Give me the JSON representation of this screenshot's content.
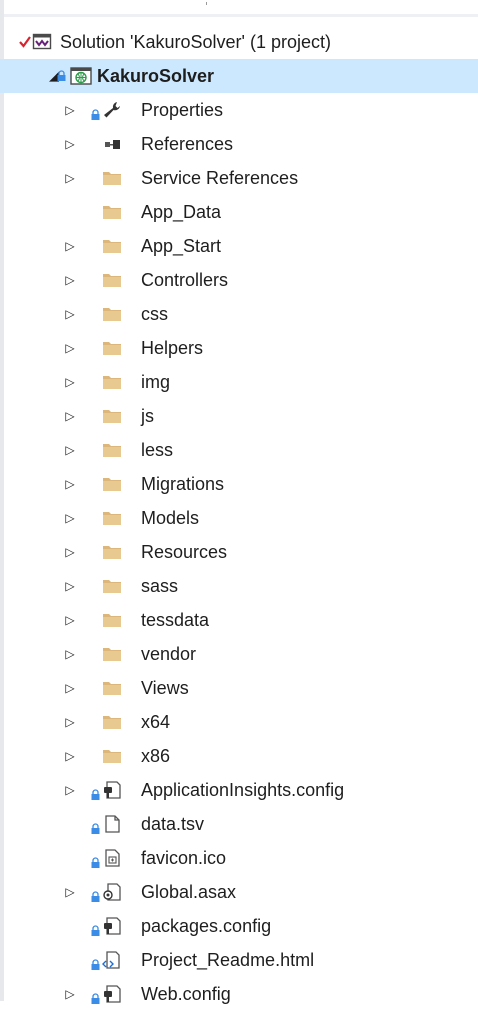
{
  "solution": {
    "label": "Solution 'KakuroSolver' (1 project)"
  },
  "project": {
    "label": "KakuroSolver"
  },
  "items": [
    {
      "label": "Properties",
      "icon": "wrench-icon",
      "expander": true,
      "lock": true
    },
    {
      "label": "References",
      "icon": "references-icon",
      "expander": true,
      "lock": false
    },
    {
      "label": "Service References",
      "icon": "folder-icon",
      "expander": true,
      "lock": false
    },
    {
      "label": "App_Data",
      "icon": "folder-icon",
      "expander": false,
      "lock": false
    },
    {
      "label": "App_Start",
      "icon": "folder-icon",
      "expander": true,
      "lock": false
    },
    {
      "label": "Controllers",
      "icon": "folder-icon",
      "expander": true,
      "lock": false
    },
    {
      "label": "css",
      "icon": "folder-icon",
      "expander": true,
      "lock": false
    },
    {
      "label": "Helpers",
      "icon": "folder-icon",
      "expander": true,
      "lock": false
    },
    {
      "label": "img",
      "icon": "folder-icon",
      "expander": true,
      "lock": false
    },
    {
      "label": "js",
      "icon": "folder-icon",
      "expander": true,
      "lock": false
    },
    {
      "label": "less",
      "icon": "folder-icon",
      "expander": true,
      "lock": false
    },
    {
      "label": "Migrations",
      "icon": "folder-icon",
      "expander": true,
      "lock": false
    },
    {
      "label": "Models",
      "icon": "folder-icon",
      "expander": true,
      "lock": false
    },
    {
      "label": "Resources",
      "icon": "folder-icon",
      "expander": true,
      "lock": false
    },
    {
      "label": "sass",
      "icon": "folder-icon",
      "expander": true,
      "lock": false
    },
    {
      "label": "tessdata",
      "icon": "folder-icon",
      "expander": true,
      "lock": false
    },
    {
      "label": "vendor",
      "icon": "folder-icon",
      "expander": true,
      "lock": false
    },
    {
      "label": "Views",
      "icon": "folder-icon",
      "expander": true,
      "lock": false
    },
    {
      "label": "x64",
      "icon": "folder-icon",
      "expander": true,
      "lock": false
    },
    {
      "label": "x86",
      "icon": "folder-icon",
      "expander": true,
      "lock": false
    },
    {
      "label": "ApplicationInsights.config",
      "icon": "config-file-icon",
      "expander": true,
      "lock": true
    },
    {
      "label": "data.tsv",
      "icon": "blank-file-icon",
      "expander": false,
      "lock": true
    },
    {
      "label": "favicon.ico",
      "icon": "image-file-icon",
      "expander": false,
      "lock": true
    },
    {
      "label": "Global.asax",
      "icon": "asax-file-icon",
      "expander": true,
      "lock": true
    },
    {
      "label": "packages.config",
      "icon": "config-file-icon",
      "expander": false,
      "lock": true
    },
    {
      "label": "Project_Readme.html",
      "icon": "html-file-icon",
      "expander": false,
      "lock": true
    },
    {
      "label": "Web.config",
      "icon": "config-file-icon",
      "expander": true,
      "lock": true
    }
  ],
  "colors": {
    "folder": "#dcb67a",
    "lock": "#3b8ce6",
    "check": "#d9232e",
    "vs_purple": "#68217a",
    "selection": "#cce8ff"
  }
}
